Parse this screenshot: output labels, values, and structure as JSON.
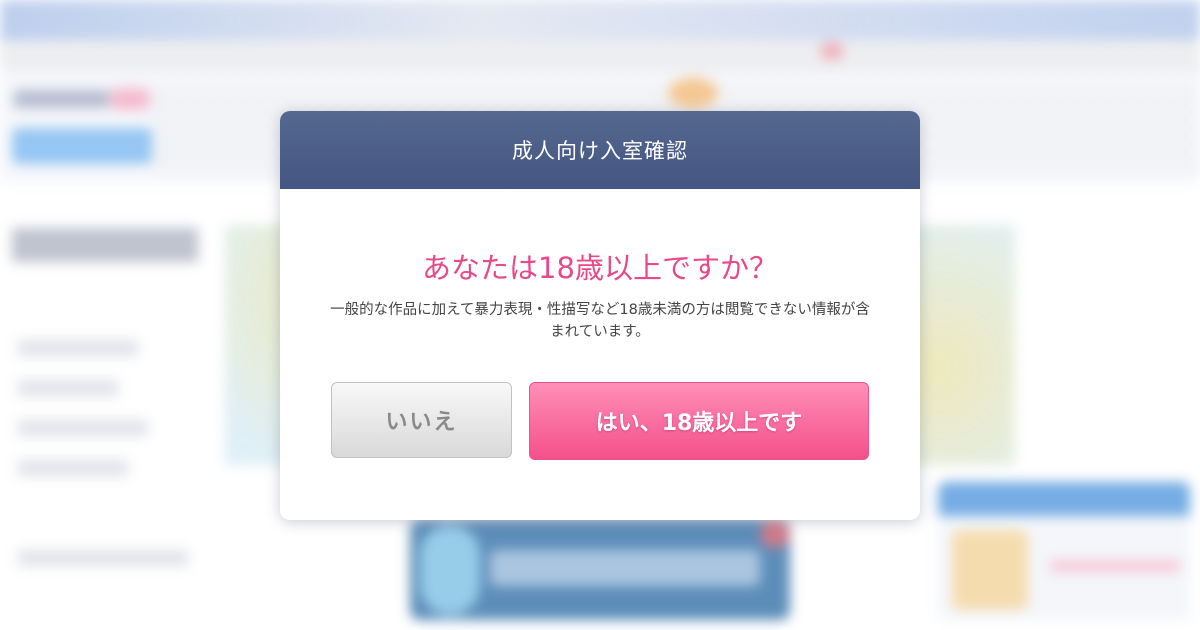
{
  "dialog": {
    "title": "成人向け入室確認",
    "question": "あなたは18歳以上ですか？",
    "description": "一般的な作品に加えて暴力表現・性描写など18歳未満の方は閲覧できない情報が含まれています。",
    "no_label": "いいえ",
    "yes_label": "はい、18歳以上です"
  },
  "colors": {
    "header": "#4a5c87",
    "question": "#e9498a",
    "yes_button": "#f5508a",
    "no_button": "#e0e0e0"
  }
}
